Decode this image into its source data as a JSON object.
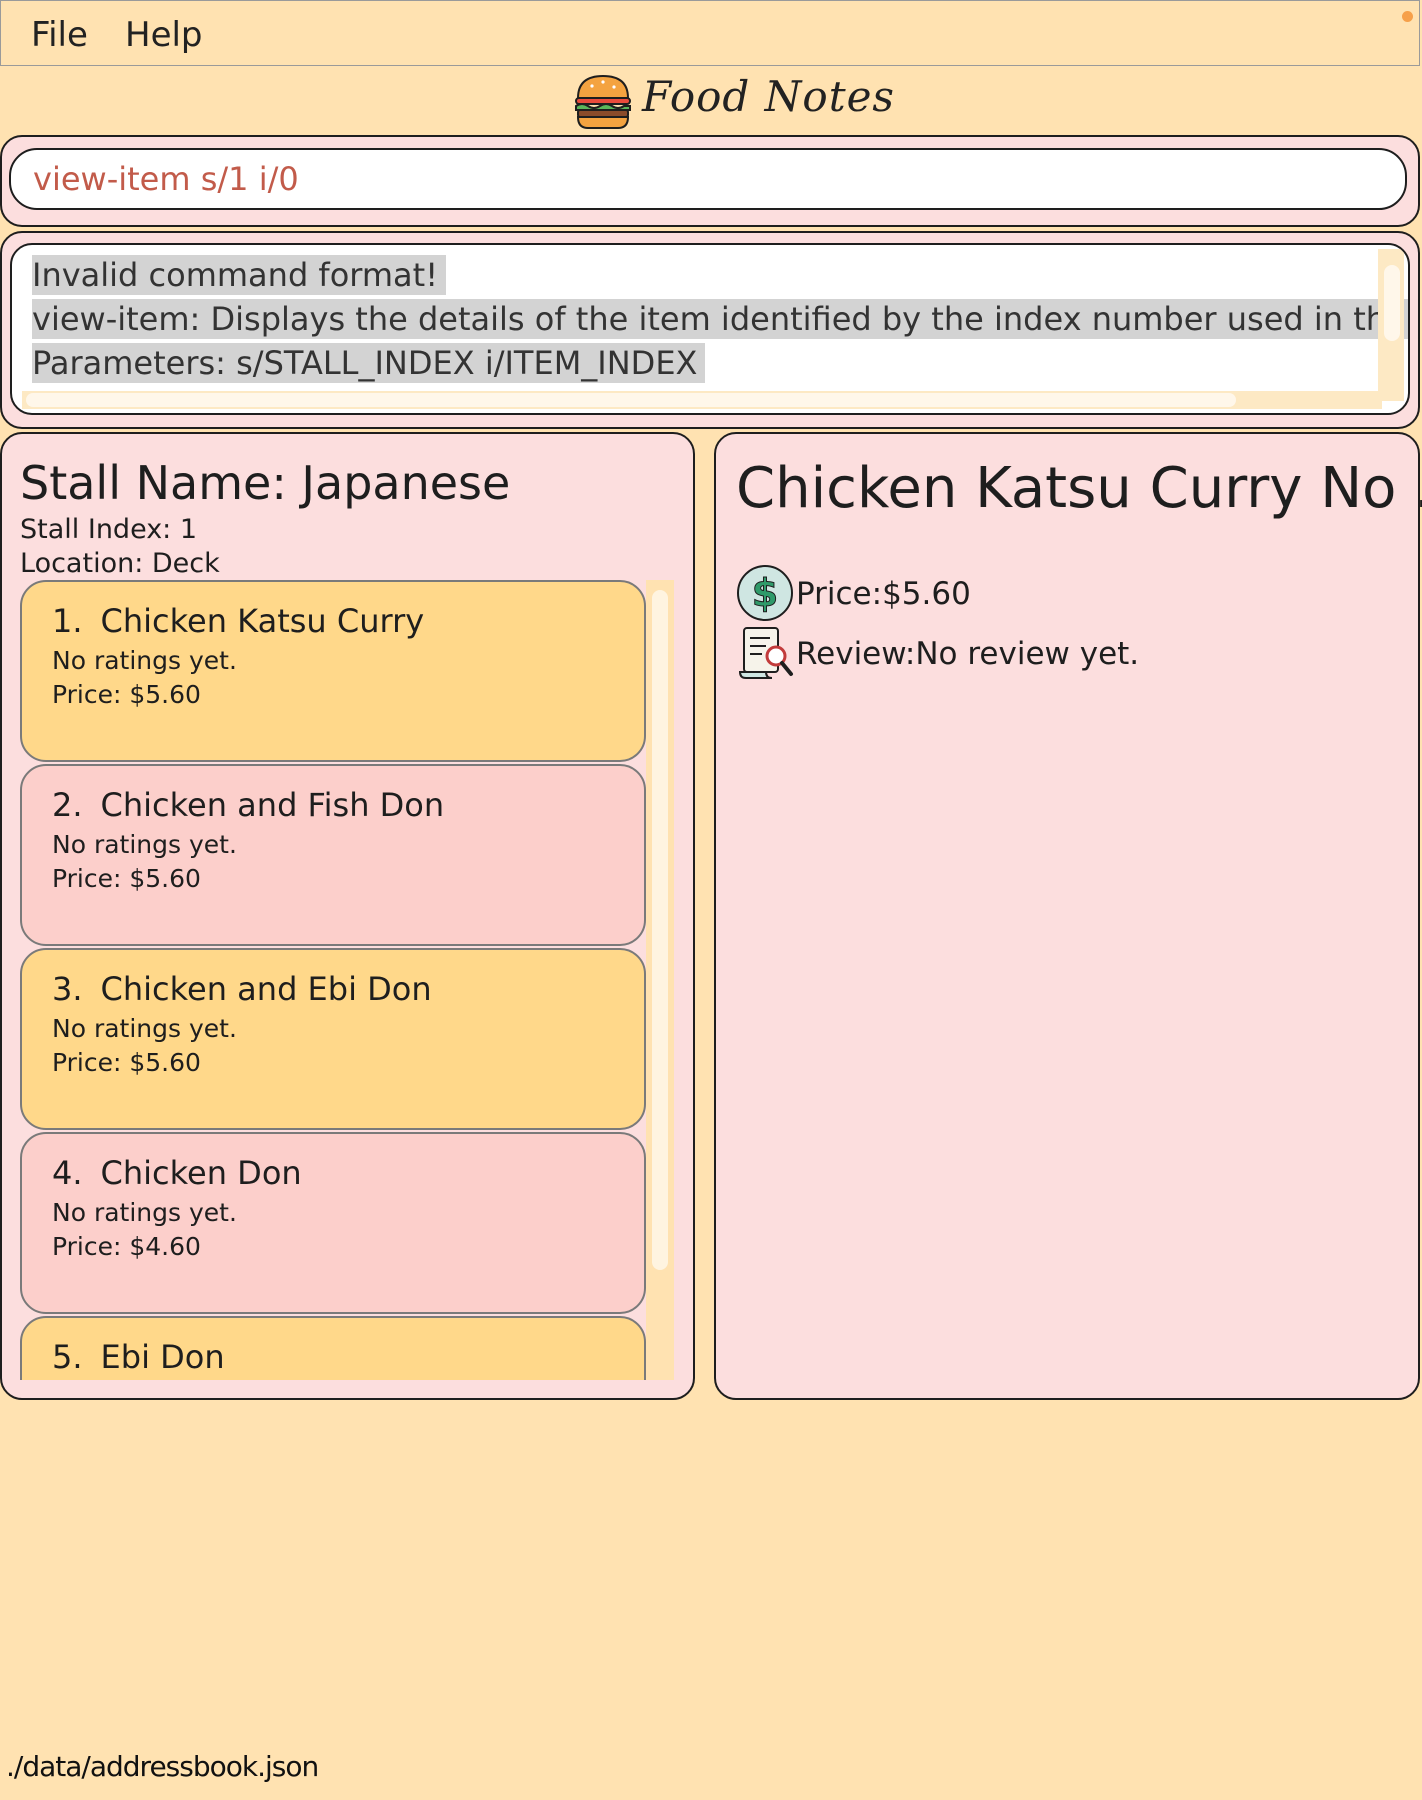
{
  "menu": {
    "file": "File",
    "help": "Help"
  },
  "app": {
    "title": "Food Notes"
  },
  "command": {
    "value": "view-item s/1 i/0"
  },
  "result": {
    "lines": [
      "Invalid command format!",
      "view-item: Displays the details of the item identified by the index number used in the displayed",
      "Parameters: s/STALL_INDEX i/ITEM_INDEX"
    ]
  },
  "stall": {
    "name": "Stall Name: Japanese",
    "index": "Stall Index: 1",
    "location": "Location: Deck"
  },
  "items": [
    {
      "num": "1.",
      "name": "Chicken Katsu Curry",
      "rating": "No ratings yet.",
      "price": "Price: $5.60"
    },
    {
      "num": "2.",
      "name": "Chicken and Fish Don",
      "rating": "No ratings yet.",
      "price": "Price: $5.60"
    },
    {
      "num": "3.",
      "name": "Chicken and Ebi Don",
      "rating": "No ratings yet.",
      "price": "Price: $5.60"
    },
    {
      "num": "4.",
      "name": "Chicken Don",
      "rating": "No ratings yet.",
      "price": "Price: $4.60"
    },
    {
      "num": "5.",
      "name": "Ebi Don",
      "rating": "",
      "price": ""
    }
  ],
  "detail": {
    "title": "Chicken Katsu Curry No ...",
    "price": "Price:$5.60",
    "review": "Review:No review yet.",
    "price_icon": "dollar-icon",
    "review_icon": "review-document-icon"
  },
  "status": {
    "path": "./data/addressbook.json"
  },
  "colors": {
    "background": "#ffe2b1",
    "panel": "#fcdede",
    "card_yellow": "#ffd88a",
    "card_pink": "#fccfcb",
    "command_text": "#c25b4a"
  }
}
